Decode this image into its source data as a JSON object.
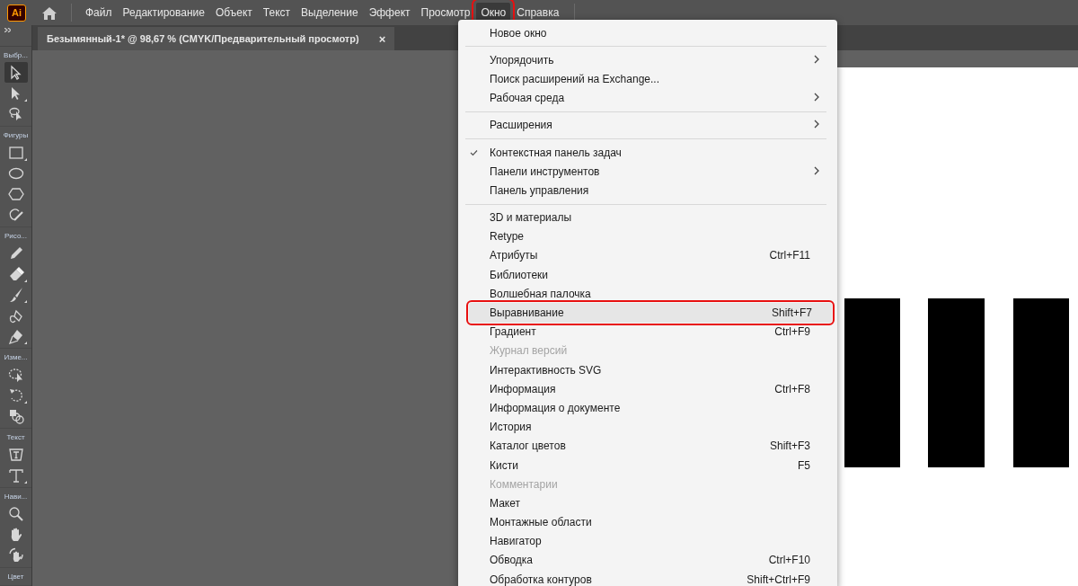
{
  "app_logo": "Ai",
  "menu_bar": {
    "items": [
      {
        "label": "Файл",
        "selected": false,
        "annotated": false
      },
      {
        "label": "Редактирование",
        "selected": false,
        "annotated": false
      },
      {
        "label": "Объект",
        "selected": false,
        "annotated": false
      },
      {
        "label": "Текст",
        "selected": false,
        "annotated": false
      },
      {
        "label": "Выделение",
        "selected": false,
        "annotated": false
      },
      {
        "label": "Эффект",
        "selected": false,
        "annotated": false
      },
      {
        "label": "Просмотр",
        "selected": false,
        "annotated": false
      },
      {
        "label": "Окно",
        "selected": true,
        "annotated": true
      },
      {
        "label": "Справка",
        "selected": false,
        "annotated": false
      }
    ]
  },
  "document_tab": {
    "title": "Безымянный-1* @ 98,67 % (CMYK/Предварительный просмотр)",
    "close": "×"
  },
  "toolbar": {
    "groups": [
      {
        "label": "Выбр...",
        "tools": [
          {
            "kind": "selection",
            "selected": true,
            "flyout": false
          },
          {
            "kind": "direct-selection",
            "selected": false,
            "flyout": true
          },
          {
            "kind": "lasso",
            "selected": false,
            "flyout": false
          }
        ]
      },
      {
        "label": "Фигуры",
        "tools": [
          {
            "kind": "rectangle",
            "selected": false,
            "flyout": true
          },
          {
            "kind": "ellipse",
            "selected": false,
            "flyout": false
          },
          {
            "kind": "polygon",
            "selected": false,
            "flyout": false
          },
          {
            "kind": "shaper",
            "selected": false,
            "flyout": false
          }
        ]
      },
      {
        "label": "Рисо...",
        "tools": [
          {
            "kind": "pencil",
            "selected": false,
            "flyout": false
          },
          {
            "kind": "eraser",
            "selected": false,
            "flyout": true
          },
          {
            "kind": "brush",
            "selected": false,
            "flyout": true
          },
          {
            "kind": "curvature",
            "selected": false,
            "flyout": false
          },
          {
            "kind": "pen",
            "selected": false,
            "flyout": true
          }
        ]
      },
      {
        "label": "Изме...",
        "tools": [
          {
            "kind": "free-transform",
            "selected": false,
            "flyout": false
          },
          {
            "kind": "rotate",
            "selected": false,
            "flyout": true
          },
          {
            "kind": "shape-builder",
            "selected": false,
            "flyout": false
          }
        ]
      },
      {
        "label": "Текст",
        "tools": [
          {
            "kind": "touch-type",
            "selected": false,
            "flyout": false
          },
          {
            "kind": "type",
            "selected": false,
            "flyout": true
          }
        ]
      },
      {
        "label": "Нави...",
        "tools": [
          {
            "kind": "zoom",
            "selected": false,
            "flyout": false
          },
          {
            "kind": "hand",
            "selected": false,
            "flyout": false
          },
          {
            "kind": "rotate-view",
            "selected": false,
            "flyout": false
          }
        ]
      },
      {
        "label": "Цвет"
      }
    ]
  },
  "window_menu": {
    "sections": [
      {
        "items": [
          {
            "label": "Новое окно",
            "checked": false,
            "disabled": false,
            "submenu": false,
            "highlighted": false,
            "annotated": false
          }
        ]
      },
      {
        "items": [
          {
            "label": "Упорядочить",
            "checked": false,
            "disabled": false,
            "submenu": true,
            "highlighted": false,
            "annotated": false
          },
          {
            "label": "Поиск расширений на Exchange...",
            "checked": false,
            "disabled": false,
            "submenu": false,
            "highlighted": false,
            "annotated": false
          },
          {
            "label": "Рабочая среда",
            "checked": false,
            "disabled": false,
            "submenu": true,
            "highlighted": false,
            "annotated": false
          }
        ]
      },
      {
        "items": [
          {
            "label": "Расширения",
            "checked": false,
            "disabled": false,
            "submenu": true,
            "highlighted": false,
            "annotated": false
          }
        ]
      },
      {
        "items": [
          {
            "label": "Контекстная панель задач",
            "checked": true,
            "disabled": false,
            "submenu": false,
            "highlighted": false,
            "annotated": false
          },
          {
            "label": "Панели инструментов",
            "checked": false,
            "disabled": false,
            "submenu": true,
            "highlighted": false,
            "annotated": false
          },
          {
            "label": "Панель управления",
            "checked": false,
            "disabled": false,
            "submenu": false,
            "highlighted": false,
            "annotated": false
          }
        ]
      },
      {
        "items": [
          {
            "label": "3D и материалы",
            "checked": false,
            "disabled": false,
            "submenu": false,
            "highlighted": false,
            "annotated": false
          },
          {
            "label": "Retype",
            "checked": false,
            "disabled": false,
            "submenu": false,
            "highlighted": false,
            "annotated": false
          },
          {
            "label": "Атрибуты",
            "shortcut": "Ctrl+F11",
            "checked": false,
            "disabled": false,
            "submenu": false,
            "highlighted": false,
            "annotated": false
          },
          {
            "label": "Библиотеки",
            "checked": false,
            "disabled": false,
            "submenu": false,
            "highlighted": false,
            "annotated": false
          },
          {
            "label": "Волшебная палочка",
            "checked": false,
            "disabled": false,
            "submenu": false,
            "highlighted": false,
            "annotated": false
          },
          {
            "label": "Выравнивание",
            "shortcut": "Shift+F7",
            "checked": false,
            "disabled": false,
            "submenu": false,
            "highlighted": true,
            "annotated": true
          },
          {
            "label": "Градиент",
            "shortcut": "Ctrl+F9",
            "checked": false,
            "disabled": false,
            "submenu": false,
            "highlighted": false,
            "annotated": false
          },
          {
            "label": "Журнал версий",
            "checked": false,
            "disabled": true,
            "submenu": false,
            "highlighted": false,
            "annotated": false
          },
          {
            "label": "Интерактивность SVG",
            "checked": false,
            "disabled": false,
            "submenu": false,
            "highlighted": false,
            "annotated": false
          },
          {
            "label": "Информация",
            "shortcut": "Ctrl+F8",
            "checked": false,
            "disabled": false,
            "submenu": false,
            "highlighted": false,
            "annotated": false
          },
          {
            "label": "Информация о документе",
            "checked": false,
            "disabled": false,
            "submenu": false,
            "highlighted": false,
            "annotated": false
          },
          {
            "label": "История",
            "checked": false,
            "disabled": false,
            "submenu": false,
            "highlighted": false,
            "annotated": false
          },
          {
            "label": "Каталог цветов",
            "shortcut": "Shift+F3",
            "checked": false,
            "disabled": false,
            "submenu": false,
            "highlighted": false,
            "annotated": false
          },
          {
            "label": "Кисти",
            "shortcut": "F5",
            "checked": false,
            "disabled": false,
            "submenu": false,
            "highlighted": false,
            "annotated": false
          },
          {
            "label": "Комментарии",
            "checked": false,
            "disabled": true,
            "submenu": false,
            "highlighted": false,
            "annotated": false
          },
          {
            "label": "Макет",
            "checked": false,
            "disabled": false,
            "submenu": false,
            "highlighted": false,
            "annotated": false
          },
          {
            "label": "Монтажные области",
            "checked": false,
            "disabled": false,
            "submenu": false,
            "highlighted": false,
            "annotated": false
          },
          {
            "label": "Навигатор",
            "checked": false,
            "disabled": false,
            "submenu": false,
            "highlighted": false,
            "annotated": false
          },
          {
            "label": "Обводка",
            "shortcut": "Ctrl+F10",
            "checked": false,
            "disabled": false,
            "submenu": false,
            "highlighted": false,
            "annotated": false
          },
          {
            "label": "Обработка контуров",
            "shortcut": "Shift+Ctrl+F9",
            "checked": false,
            "disabled": false,
            "submenu": false,
            "highlighted": false,
            "annotated": false
          }
        ]
      }
    ]
  }
}
